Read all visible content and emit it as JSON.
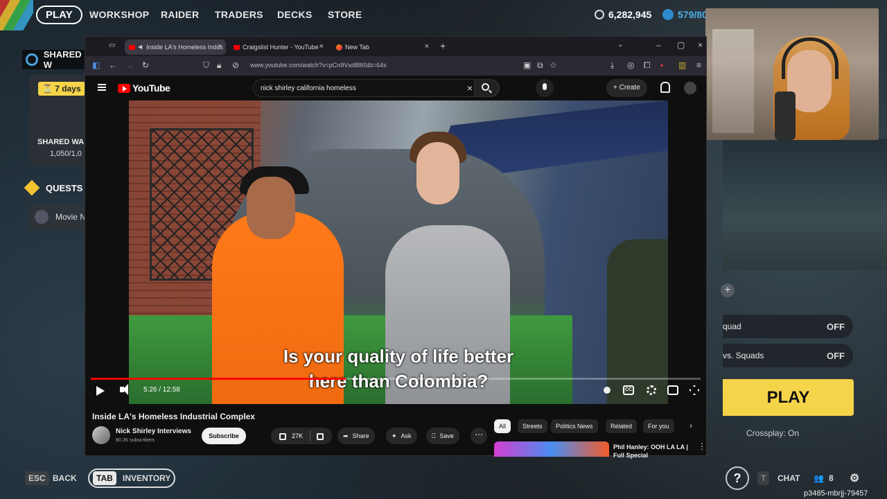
{
  "game": {
    "nav": {
      "play": "PLAY",
      "items": [
        "WORKSHOP",
        "RAIDER",
        "TRADERS",
        "DECKS",
        "STORE"
      ],
      "coins": "6,282,945",
      "creds": "579/80"
    },
    "left": {
      "shared_header": "SHARED W",
      "days": "7 days",
      "shared_card_label": "SHARED WA",
      "progress": "1,050/1,0",
      "quests_header": "QUESTS",
      "quest_item": "Movie N"
    },
    "right": {
      "option1_label": "quad",
      "option1_value": "OFF",
      "option2_label": "vs. Squads",
      "option2_value": "OFF",
      "play": "PLAY",
      "crossplay": "Crossplay: On"
    },
    "bottom": {
      "esc": "ESC",
      "back": "BACK",
      "tab": "TAB",
      "inventory": "INVENTORY",
      "t_key": "T",
      "chat": "CHAT",
      "friends_count": "8",
      "session_id": "p3485-mbrjj-79457"
    }
  },
  "browser": {
    "tabs": [
      {
        "title": "Inside LA's Homeless Indus"
      },
      {
        "title": "Craigslist Hunter - YouTube"
      },
      {
        "title": "New Tab"
      }
    ],
    "url": "www.youtube.com/watch?v=pCn9Vxd88I0&t=64s"
  },
  "youtube": {
    "logo": "YouTube",
    "search_query": "nick shirley california homeless",
    "create_label": "Create",
    "subtitle_line1": "Is your quality of life better",
    "subtitle_line2": "here than Colombia?",
    "time": "5:26 / 12:58",
    "progress_fraction": 0.418,
    "video_title": "Inside LA's Homeless Industrial Complex",
    "channel_name": "Nick Shirley Interviews",
    "channel_subs": "80.2K subscribers",
    "subscribe": "Subscribe",
    "likes": "27K",
    "share": "Share",
    "ask": "Ask",
    "save": "Save",
    "chips": [
      "All",
      "Streets",
      "Politics News",
      "Related",
      "For you"
    ],
    "rec_title": "Phil Hanley: OOH LA LA | Full Special"
  }
}
